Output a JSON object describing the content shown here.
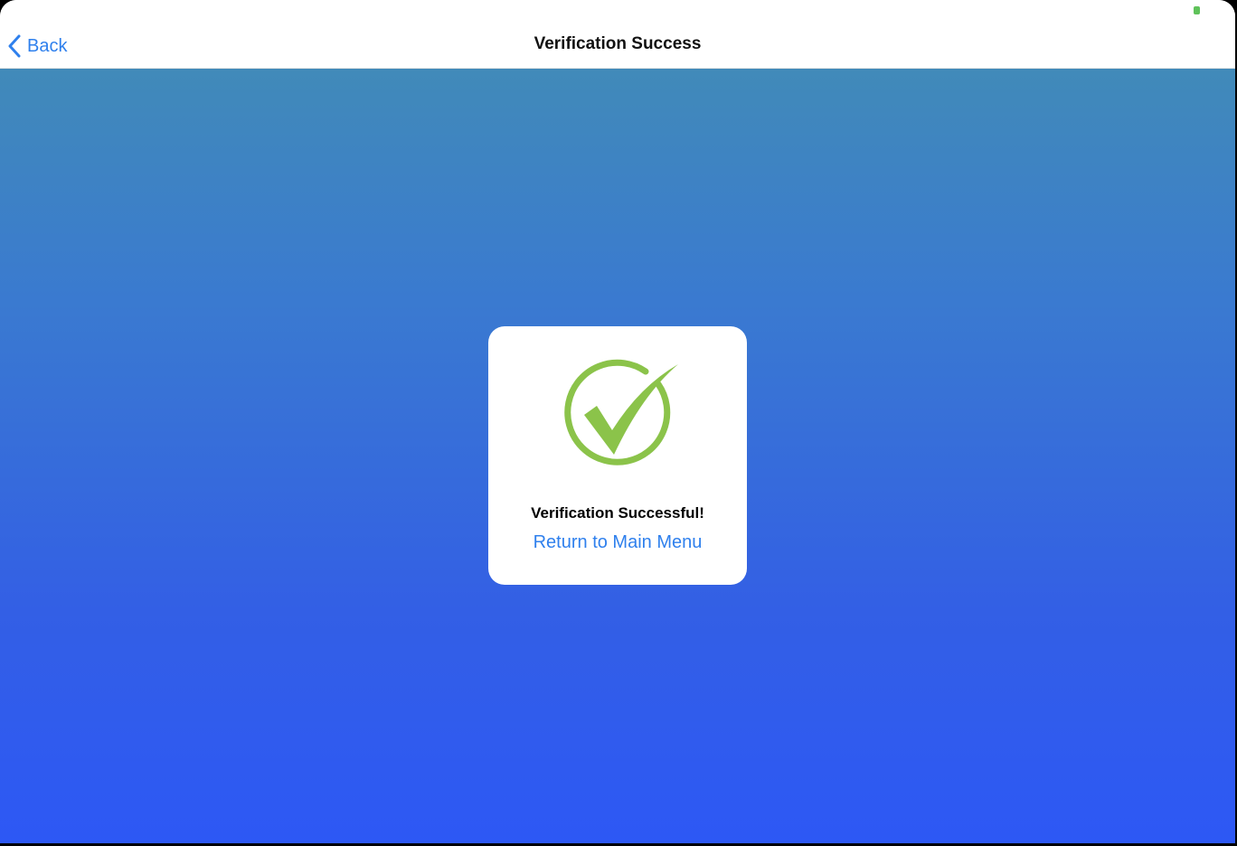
{
  "navbar": {
    "back_label": "Back",
    "title": "Verification Success"
  },
  "card": {
    "message": "Verification Successful!",
    "return_label": "Return to Main Menu"
  },
  "icons": {
    "back": "chevron-left-icon",
    "success": "check-circle-icon"
  },
  "colors": {
    "accent": "#2f80ed",
    "success": "#8bc34a",
    "status_indicator": "#5fc25a",
    "gradient_top": "#418ab9",
    "gradient_bottom": "#2d58f5"
  }
}
